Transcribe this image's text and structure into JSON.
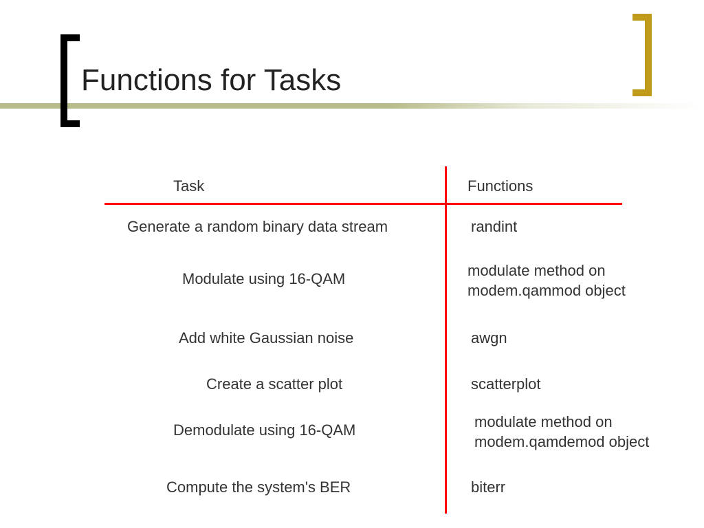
{
  "title": "Functions for Tasks",
  "headers": {
    "task": "Task",
    "func": "Functions"
  },
  "rows": [
    {
      "task": "Generate a random binary data stream",
      "func": "randint"
    },
    {
      "task": "Modulate using 16-QAM",
      "func": "modulate method on modem.qammod object"
    },
    {
      "task": "Add white Gaussian noise",
      "func": "awgn"
    },
    {
      "task": "Create a scatter plot",
      "func": "scatterplot"
    },
    {
      "task": "Demodulate using 16-QAM",
      "func": "modulate method on modem.qamdemod object"
    },
    {
      "task": "Compute the system's BER",
      "func": "biterr"
    }
  ]
}
